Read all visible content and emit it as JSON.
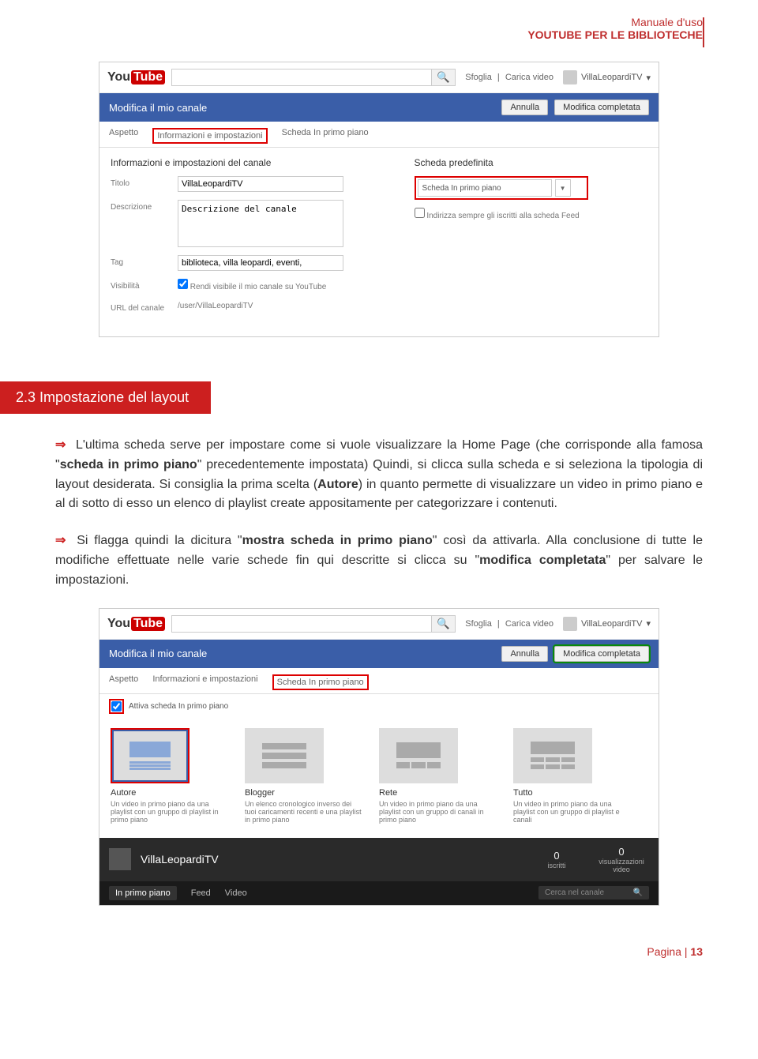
{
  "header": {
    "line1": "Manuale d'uso",
    "line2": "YOUTUBE PER LE BIBLIOTECHE"
  },
  "shot1": {
    "logo": {
      "you": "You",
      "tube": "Tube"
    },
    "search_placeholder": "",
    "link_browse": "Sfoglia",
    "link_upload": "Carica video",
    "user": "VillaLeopardiTV",
    "bluebar_title": "Modifica il mio canale",
    "btn_cancel": "Annulla",
    "btn_done": "Modifica completata",
    "tab_aspetto": "Aspetto",
    "tab_info": "Informazioni e impostazioni",
    "tab_featured": "Scheda In primo piano",
    "head_left": "Informazioni e impostazioni del canale",
    "head_right": "Scheda predefinita",
    "label_title": "Titolo",
    "val_title": "VillaLeopardiTV",
    "label_desc": "Descrizione",
    "val_desc": "Descrizione del canale",
    "label_tag": "Tag",
    "val_tag": "biblioteca, villa leopardi, eventi,",
    "label_vis": "Visibilità",
    "val_vis": "Rendi visibile il mio canale su YouTube",
    "label_url": "URL del canale",
    "val_url": "/user/VillaLeopardiTV",
    "dd_value": "Scheda In primo piano",
    "check_label": "Indirizza sempre gli iscritti alla scheda Feed"
  },
  "section": {
    "heading": "2.3   Impostazione del layout"
  },
  "para1_pre": "L'ultima scheda serve per impostare come si vuole visualizzare la Home Page (che corrisponde alla famosa \"",
  "para1_b1": "scheda in primo piano",
  "para1_mid": "\" precedentemente impostata) Quindi, si clicca sulla scheda e si seleziona la tipologia di layout desiderata. Si consiglia la prima scelta (",
  "para1_b2": "Autore",
  "para1_end": ") in quanto permette di visualizzare un video in primo piano e al di sotto di esso un elenco di playlist create appositamente per categorizzare i contenuti.",
  "para2_pre": "Si flagga quindi la dicitura \"",
  "para2_b1": "mostra scheda in primo piano",
  "para2_mid": "\" così da attivarla. Alla conclusione di tutte le modifiche effettuate nelle varie schede fin qui descritte si clicca su \"",
  "para2_b2": "modifica completata",
  "para2_end": "\" per salvare le impostazioni.",
  "shot2": {
    "logo": {
      "you": "You",
      "tube": "Tube"
    },
    "link_browse": "Sfoglia",
    "link_upload": "Carica video",
    "user": "VillaLeopardiTV",
    "bluebar_title": "Modifica il mio canale",
    "btn_cancel": "Annulla",
    "btn_done": "Modifica completata",
    "tab_aspetto": "Aspetto",
    "tab_info": "Informazioni e impostazioni",
    "tab_featured": "Scheda In primo piano",
    "check_attiva": "Attiva scheda In primo piano",
    "opts": [
      {
        "name": "Autore",
        "desc": "Un video in primo piano da una playlist con un gruppo di playlist in primo piano"
      },
      {
        "name": "Blogger",
        "desc": "Un elenco cronologico inverso dei tuoi caricamenti recenti e una playlist in primo piano"
      },
      {
        "name": "Rete",
        "desc": "Un video in primo piano da una playlist con un gruppo di canali in primo piano"
      },
      {
        "name": "Tutto",
        "desc": "Un video in primo piano da una playlist con un gruppo di playlist e canali"
      }
    ],
    "channel_name": "VillaLeopardiTV",
    "stat1_n": "0",
    "stat1_l": "iscritti",
    "stat2_n": "0",
    "stat2_l": "visualizzazioni video",
    "dtab1": "In primo piano",
    "dtab2": "Feed",
    "dtab3": "Video",
    "search2_ph": "Cerca nel canale"
  },
  "footer": {
    "label": "Pagina | ",
    "num": "13"
  }
}
